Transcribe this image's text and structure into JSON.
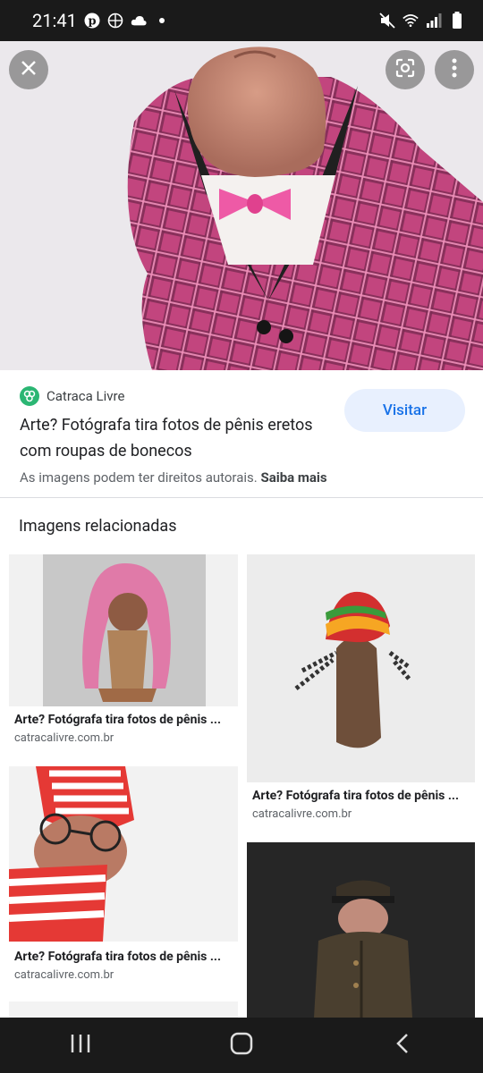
{
  "status_bar": {
    "time": "21:41",
    "left_icons": [
      "pinterest-icon",
      "vpn-icon",
      "cloud-icon",
      "dot-icon"
    ],
    "right_icons": [
      "mute-icon",
      "wifi-icon",
      "signal-icon",
      "battery-icon"
    ]
  },
  "viewer": {
    "close_icon": "close-icon",
    "lens_icon": "google-lens-icon",
    "more_icon": "more-vert-icon"
  },
  "result": {
    "source": "Catraca Livre",
    "title": "Arte? Fotógrafa tira fotos de pênis eretos com roupas de bonecos",
    "visit_label": "Visitar",
    "copyright_text": "As imagens podem ter direitos autorais.",
    "learn_more": "Saiba mais"
  },
  "related": {
    "heading": "Imagens relacionadas",
    "items": [
      {
        "title": "Arte? Fotógrafa tira fotos de pênis ...",
        "domain": "catracalivre.com.br"
      },
      {
        "title": "Arte? Fotógrafa tira fotos de pênis ...",
        "domain": "catracalivre.com.br"
      },
      {
        "title": "Arte? Fotógrafa tira fotos de pênis ...",
        "domain": "catracalivre.com.br"
      }
    ]
  },
  "nav": {
    "recents_icon": "recents-icon",
    "home_icon": "home-icon",
    "back_icon": "back-icon"
  },
  "colors": {
    "accent": "#1a73e8",
    "visit_bg": "#e8f0fe",
    "bar_bg": "#1a1a1a",
    "source_logo": "#2bb673"
  }
}
